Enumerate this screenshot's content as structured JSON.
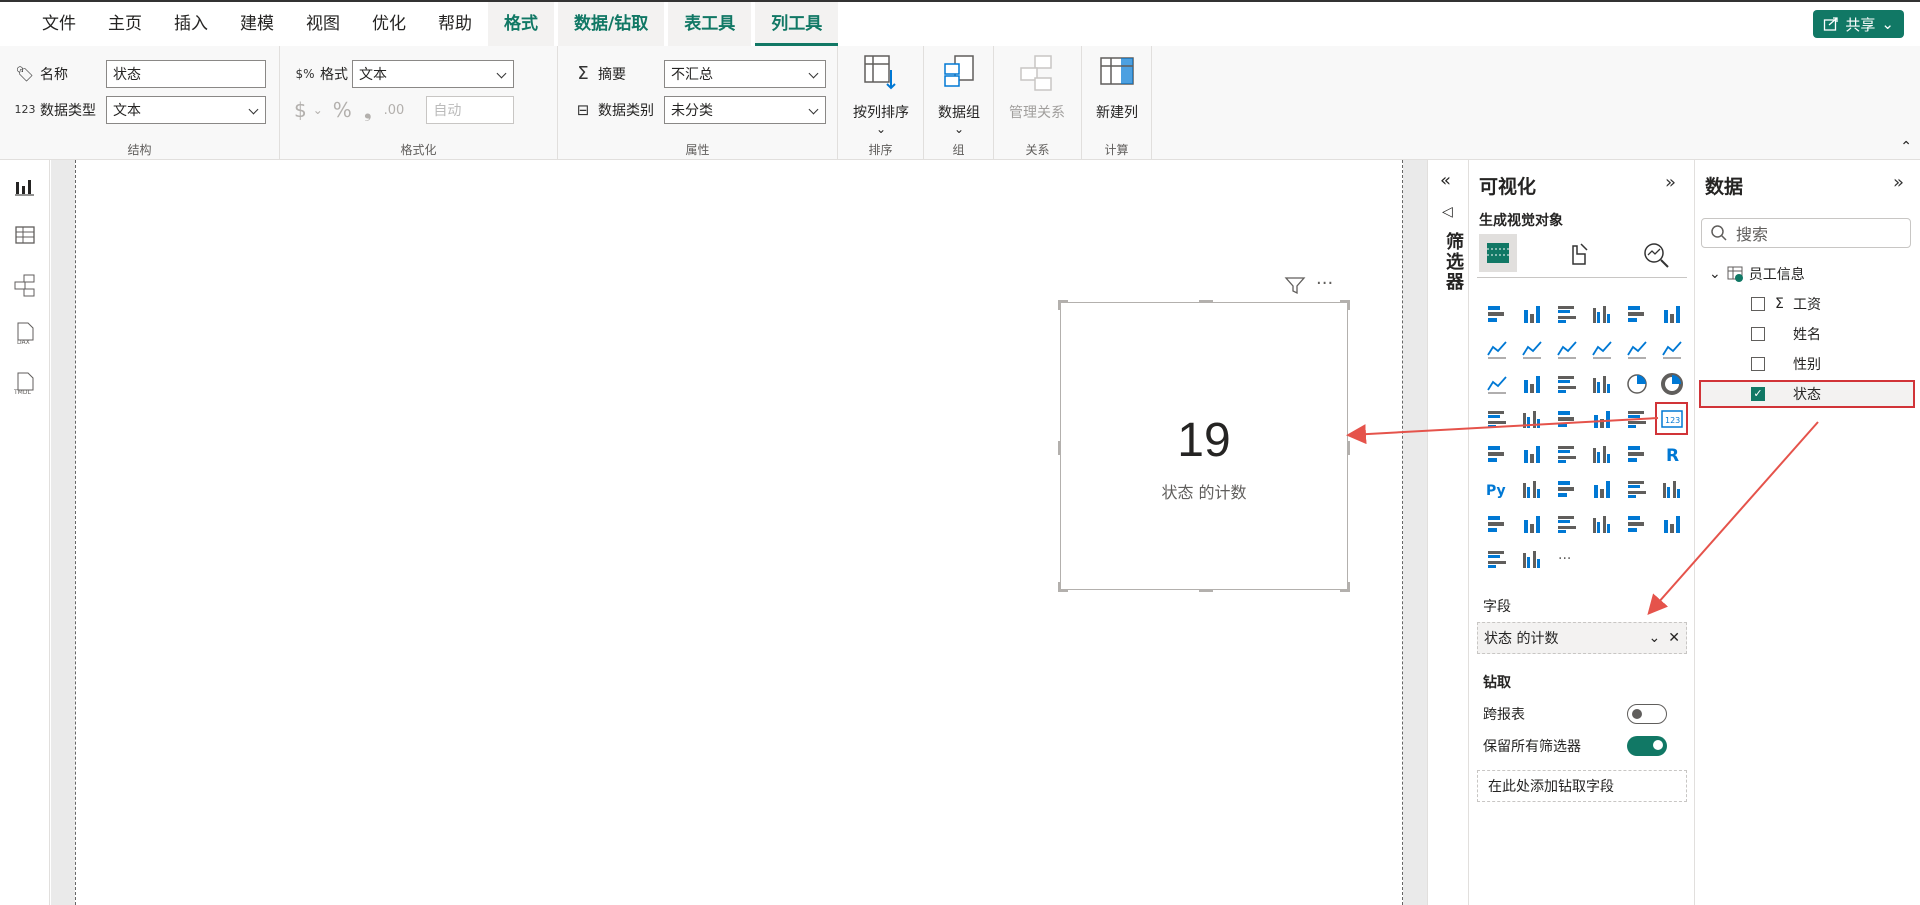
{
  "menu": {
    "items": [
      "文件",
      "主页",
      "插入",
      "建模",
      "视图",
      "优化",
      "帮助"
    ],
    "context_tabs": [
      "格式",
      "数据/钻取",
      "表工具",
      "列工具"
    ],
    "share": "共享"
  },
  "ribbon": {
    "structure": {
      "name_label": "名称",
      "name_value": "状态",
      "type_label": "数据类型",
      "type_value": "文本",
      "group": "结构"
    },
    "formatting": {
      "format_label": "格式",
      "format_value": "文本",
      "auto_value": "自动",
      "group": "格式化"
    },
    "properties": {
      "summary_label": "摘要",
      "summary_value": "不汇总",
      "category_label": "数据类别",
      "category_value": "未分类",
      "group": "属性"
    },
    "sort": {
      "label": "按列排序",
      "group": "排序"
    },
    "groups": {
      "label": "数据组",
      "group": "组"
    },
    "relations": {
      "label": "管理关系",
      "group": "关系"
    },
    "calc": {
      "label": "新建列",
      "group": "计算"
    }
  },
  "card": {
    "value": "19",
    "label": "状态 的计数"
  },
  "filters": {
    "title": "筛选器"
  },
  "viz": {
    "title": "可视化",
    "build_title": "生成视觉对象",
    "fields_label": "字段",
    "field_value": "状态 的计数",
    "drill_label": "钻取",
    "cross_report_label": "跨报表",
    "cross_report": false,
    "keep_filters_label": "保留所有筛选器",
    "keep_filters": true,
    "drill_add": "在此处添加钻取字段",
    "more": "···"
  },
  "data": {
    "title": "数据",
    "search_placeholder": "搜索",
    "table_name": "员工信息",
    "fields": [
      {
        "name": "工资",
        "checked": false,
        "sigma": true
      },
      {
        "name": "姓名",
        "checked": false,
        "sigma": false
      },
      {
        "name": "性别",
        "checked": false,
        "sigma": false
      },
      {
        "name": "状态",
        "checked": true,
        "sigma": false
      }
    ]
  },
  "colors": {
    "accent": "#117865",
    "highlight": "#d13438"
  }
}
